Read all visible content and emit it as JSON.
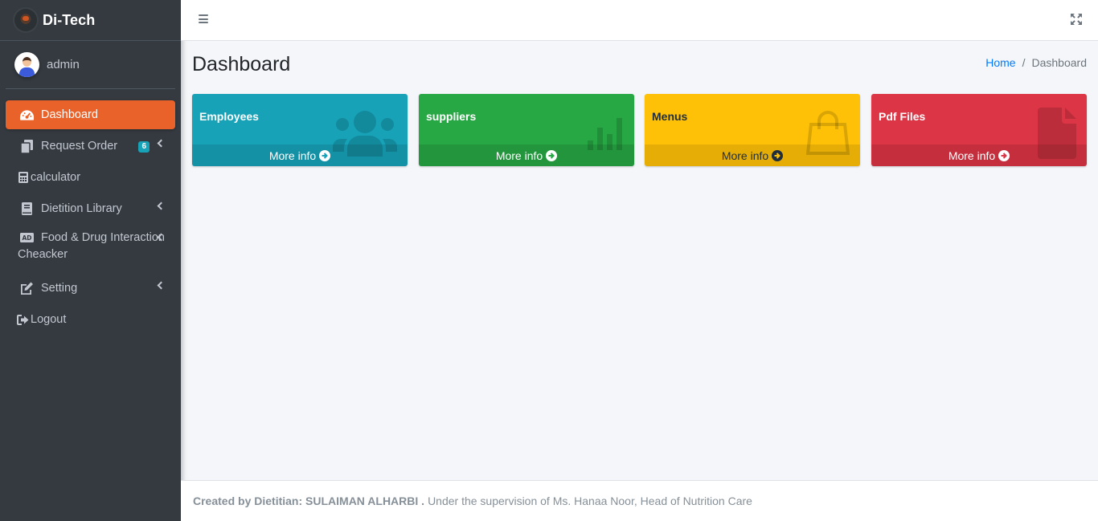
{
  "brand": {
    "name": "Di-Tech"
  },
  "user": {
    "name": "admin"
  },
  "sidebar": {
    "items": [
      {
        "label": "Dashboard",
        "icon": "tachometer-icon",
        "active": true
      },
      {
        "label": "Request Order",
        "icon": "copy-icon",
        "badge": "6"
      },
      {
        "label": "calculator",
        "icon": "calculator-icon"
      },
      {
        "label": "Dietition Library",
        "icon": "book-icon"
      },
      {
        "label": "Food & Drug Interaction Cheacker",
        "icon": "ad-icon"
      },
      {
        "label": "Setting",
        "icon": "edit-icon"
      },
      {
        "label": "Logout",
        "icon": "sign-out-icon"
      }
    ]
  },
  "header": {
    "page_title": "Dashboard"
  },
  "breadcrumb": {
    "home": "Home",
    "current": "Dashboard"
  },
  "boxes": [
    {
      "title": "Employees",
      "link": "More info",
      "color": "#17a2b8",
      "icon": "users-icon"
    },
    {
      "title": "suppliers",
      "link": "More info",
      "color": "#28a745",
      "icon": "bar-chart-icon"
    },
    {
      "title": "Menus",
      "link": "More info",
      "color": "#ffc107",
      "icon": "shopping-bag-icon"
    },
    {
      "title": "Pdf Files",
      "link": "More info",
      "color": "#dc3545",
      "icon": "file-icon"
    }
  ],
  "footer": {
    "credit": "Created by Dietitian: SULAIMAN ALHARBI .",
    "supervision": "Under the supervision of Ms. Hanaa Noor, Head of Nutrition Care"
  },
  "colors": {
    "sidebar_bg": "#343a40",
    "active_item": "#e8622a",
    "content_bg": "#f4f6f9"
  }
}
